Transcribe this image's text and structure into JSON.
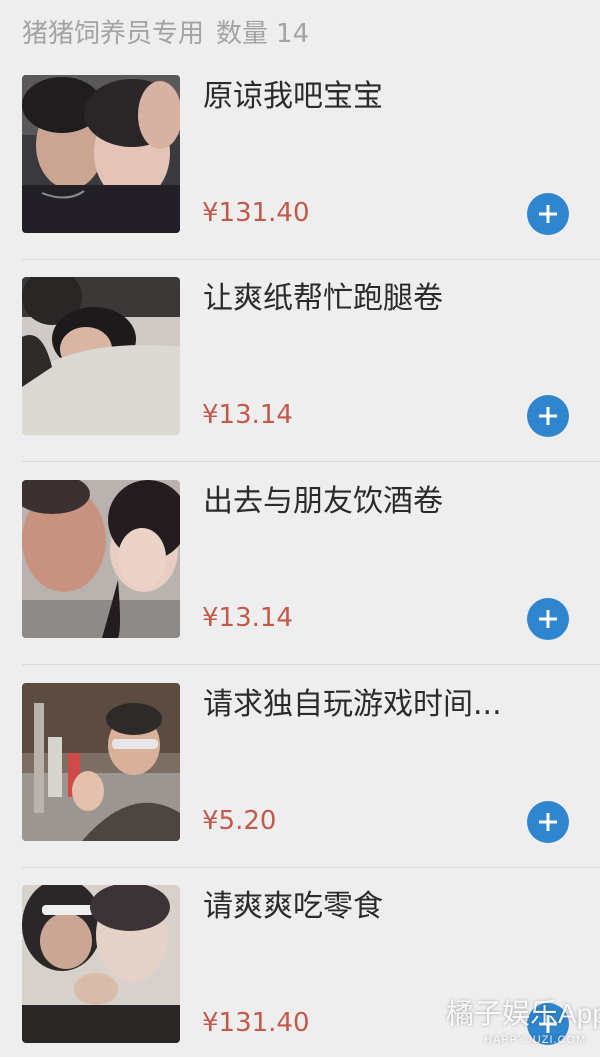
{
  "category": {
    "name": "猪猪饲养员专用",
    "count_label": "数量",
    "count": "14"
  },
  "items": [
    {
      "title": "原谅我吧宝宝",
      "price": "¥131.40"
    },
    {
      "title": "让爽纸帮忙跑腿卷",
      "price": "¥13.14"
    },
    {
      "title": "出去与朋友饮酒卷",
      "price": "¥13.14"
    },
    {
      "title": "请求独自玩游戏时间...",
      "price": "¥5.20"
    },
    {
      "title": "请爽爽吃零食",
      "price": "¥131.40"
    }
  ],
  "icons": {
    "add": "plus-icon"
  },
  "colors": {
    "background": "#eeeeee",
    "price": "#c15a4c",
    "add_button": "#2f86cf",
    "title": "#2b2b2b",
    "header": "#a3a3a3"
  },
  "watermark": {
    "name": "橘子娱乐App",
    "sub": "HAPPYJUZI.COM"
  }
}
